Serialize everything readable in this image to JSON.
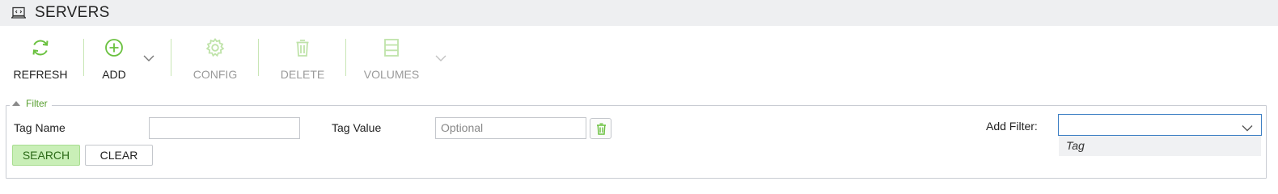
{
  "title": {
    "text": "SERVERS",
    "icon": "server-icon"
  },
  "toolbar": {
    "refresh": {
      "label": "REFRESH",
      "icon": "refresh-icon",
      "enabled": true
    },
    "add": {
      "label": "ADD",
      "icon": "plus-circle-icon",
      "enabled": true
    },
    "config": {
      "label": "CONFIG",
      "icon": "gear-icon",
      "enabled": false
    },
    "delete": {
      "label": "DELETE",
      "icon": "trash-icon",
      "enabled": false
    },
    "volumes": {
      "label": "VOLUMES",
      "icon": "volumes-icon",
      "enabled": false
    }
  },
  "filter": {
    "legend": "Filter",
    "tag_name_label": "Tag Name",
    "tag_name_value": "",
    "tag_value_label": "Tag Value",
    "tag_value_placeholder": "Optional",
    "search_label": "SEARCH",
    "clear_label": "CLEAR",
    "add_filter_label": "Add Filter:",
    "add_filter_selected": "",
    "add_filter_options": [
      "Tag"
    ]
  },
  "colors": {
    "accent": "#6ac13f",
    "accent_disabled": "#bfe3a9",
    "title_bar": "#eeeff1",
    "select_focus_border": "#3d7fc4"
  }
}
